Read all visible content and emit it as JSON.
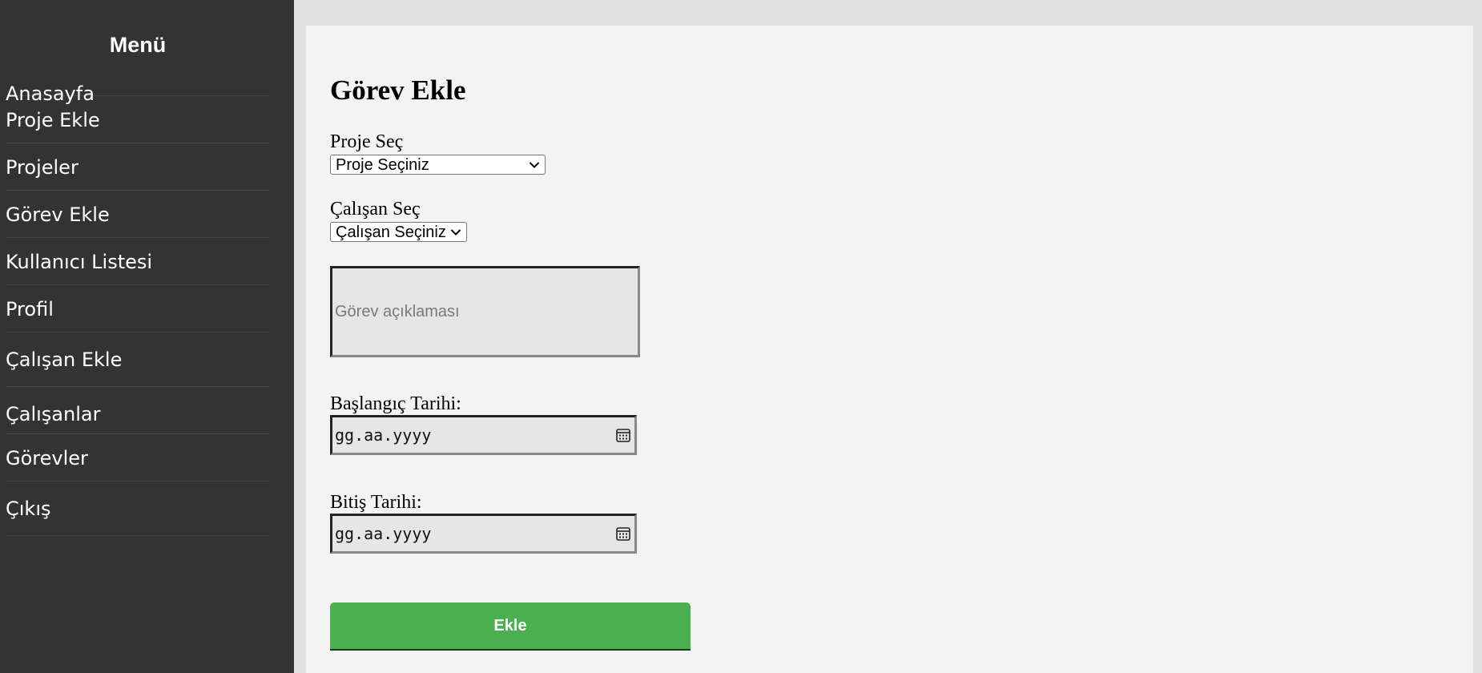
{
  "sidebar": {
    "title": "Menü",
    "items": [
      {
        "label": "Anasayfa"
      },
      {
        "label": "Proje Ekle"
      },
      {
        "label": "Projeler"
      },
      {
        "label": "Görev Ekle"
      },
      {
        "label": "Kullanıcı Listesi"
      },
      {
        "label": "Profil"
      },
      {
        "label": "Çalışan Ekle"
      },
      {
        "label": "Çalışanlar"
      },
      {
        "label": "Görevler"
      },
      {
        "label": "Çıkış"
      }
    ]
  },
  "form": {
    "title": "Görev Ekle",
    "project_label": "Proje Seç",
    "project_selected": "Proje Seçiniz",
    "employee_label": "Çalışan Seç",
    "employee_selected": "Çalışan Seçiniz",
    "description_placeholder": "Görev açıklaması",
    "start_label": "Başlangıç Tarihi:",
    "start_value": "gg.aa.yyyy",
    "end_label": "Bitiş Tarihi:",
    "end_value": "gg.aa.yyyy",
    "submit_label": "Ekle"
  },
  "icons": {
    "select_chevron": "chevron-down-icon",
    "date_picker": "calendar-icon"
  },
  "colors": {
    "sidebar_bg": "#333333",
    "main_bg": "#f3f3f3",
    "page_bg": "#e0e0e0",
    "submit_bg": "#4caf50",
    "submit_text": "#ffffff"
  }
}
